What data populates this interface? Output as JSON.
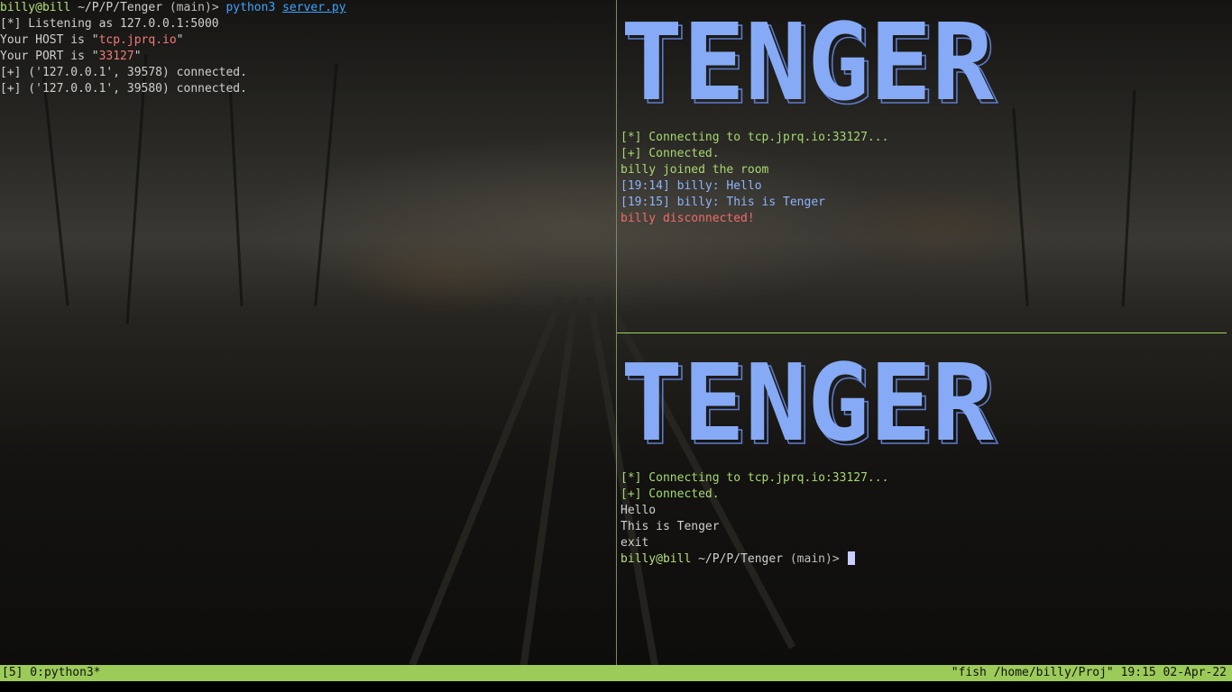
{
  "left_pane": {
    "prompt": {
      "user_host": "billy@bill",
      "path": " ~/P/P/Tenger",
      "branch": " (main)> ",
      "command": "python3",
      "argument": "server.py"
    },
    "lines": [
      {
        "text": "[*] Listening as 127.0.0.1:5000"
      },
      {
        "pre": "Your HOST is \"",
        "val": "tcp.jprq.io",
        "post": "\""
      },
      {
        "pre": "Your PORT is \"",
        "val": "33127",
        "post": "\""
      },
      {
        "text": "[+] ('127.0.0.1', 39578) connected."
      },
      {
        "text": "[+] ('127.0.0.1', 39580) connected."
      }
    ]
  },
  "top_right_pane": {
    "banner": "TENGER",
    "lines": [
      "[*] Connecting to tcp.jprq.io:33127...",
      "[+] Connected.",
      "billy joined the room",
      "[19:14] billy: Hello",
      "[19:15] billy: This is Tenger",
      "billy disconnected!"
    ]
  },
  "bottom_right_pane": {
    "banner": "TENGER",
    "lines": [
      "[*] Connecting to tcp.jprq.io:33127...",
      "[+] Connected.",
      "Hello",
      "This is Tenger",
      "exit"
    ],
    "prompt": {
      "user_host": "billy@bill",
      "path": " ~/P/P/Tenger",
      "branch": " (main)> "
    }
  },
  "status_bar": {
    "left": "[5] 0:python3*",
    "right": "\"fish /home/billy/Proj\" 19:15 02-Apr-22"
  },
  "colors": {
    "status_bg": "#9ccb5a",
    "banner_fill": "#86aaf5",
    "green_text": "#a6d971",
    "blue_text": "#8cb4ff",
    "red_text": "#f26b6b"
  }
}
